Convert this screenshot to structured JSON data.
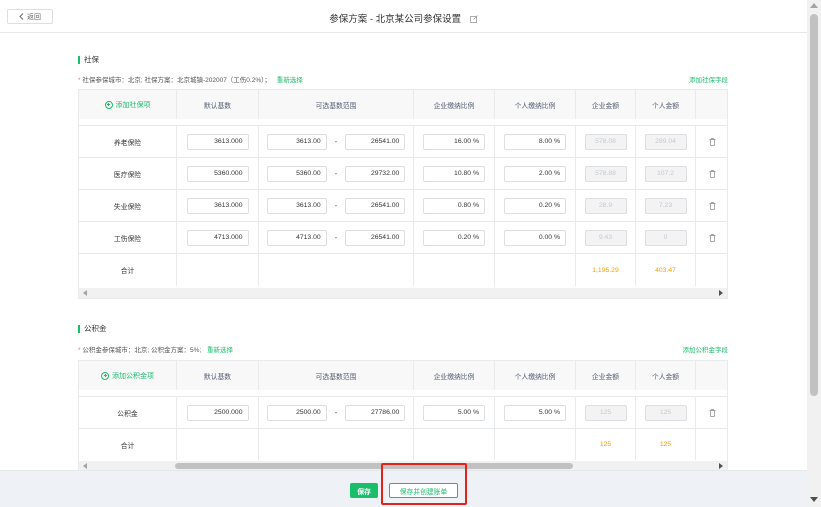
{
  "header": {
    "back_label": "返回",
    "title": "参保方案 - 北京某公司参保设置"
  },
  "social": {
    "section_title": "社保",
    "info_star": "*",
    "info_text": "社保参保城市：北京;   社保方案：北京城镇-202007（工伤0.2%）；",
    "reselect_label": "重新选择",
    "add_field_label": "添加社保字段",
    "columns": {
      "add_item": "添加社保项",
      "default_base": "默认基数",
      "base_range": "可选基数范围",
      "company_ratio": "企业缴纳比例",
      "personal_ratio": "个人缴纳比例",
      "company_amount": "企业金额",
      "personal_amount": "个人金额"
    },
    "rows": [
      {
        "name": "养老保险",
        "default_base": "3613.000",
        "min": "3613.00",
        "max": "26541.00",
        "company_ratio": "16.00 %",
        "personal_ratio": "8.00 %",
        "company_amount": "578.08",
        "personal_amount": "289.04"
      },
      {
        "name": "医疗保险",
        "default_base": "5360.000",
        "min": "5360.00",
        "max": "29732.00",
        "company_ratio": "10.80 %",
        "personal_ratio": "2.00 %",
        "company_amount": "578.88",
        "personal_amount": "107.2"
      },
      {
        "name": "失业保险",
        "default_base": "3613.000",
        "min": "3613.00",
        "max": "26541.00",
        "company_ratio": "0.80 %",
        "personal_ratio": "0.20 %",
        "company_amount": "28.9",
        "personal_amount": "7.23"
      },
      {
        "name": "工伤保险",
        "default_base": "4713.000",
        "min": "4713.00",
        "max": "26541.00",
        "company_ratio": "0.20 %",
        "personal_ratio": "0.00 %",
        "company_amount": "9.43",
        "personal_amount": "0"
      }
    ],
    "total": {
      "label": "合计",
      "company_amount": "1,195.29",
      "personal_amount": "403.47"
    }
  },
  "fund": {
    "section_title": "公积金",
    "info_star": "*",
    "info_text": "公积金参保城市：北京;   公积金方案：5%;",
    "reselect_label": "重新选择",
    "add_field_label": "添加公积金字段",
    "columns": {
      "add_item": "添加公积金项",
      "default_base": "默认基数",
      "base_range": "可选基数范围",
      "company_ratio": "企业缴纳比例",
      "personal_ratio": "个人缴纳比例",
      "company_amount": "企业金额",
      "personal_amount": "个人金额"
    },
    "rows": [
      {
        "name": "公积金",
        "default_base": "2500.000",
        "min": "2500.00",
        "max": "27786.00",
        "company_ratio": "5.00 %",
        "personal_ratio": "5.00 %",
        "company_amount": "125",
        "personal_amount": "125"
      }
    ],
    "total": {
      "label": "合计",
      "company_amount": "125",
      "personal_amount": "125"
    }
  },
  "footer": {
    "save_label": "保存",
    "save_bill_label": "保存并创建账单"
  },
  "colors": {
    "accent": "#19be6b",
    "orange": "#ff9900",
    "highlight": "#e0231b"
  }
}
